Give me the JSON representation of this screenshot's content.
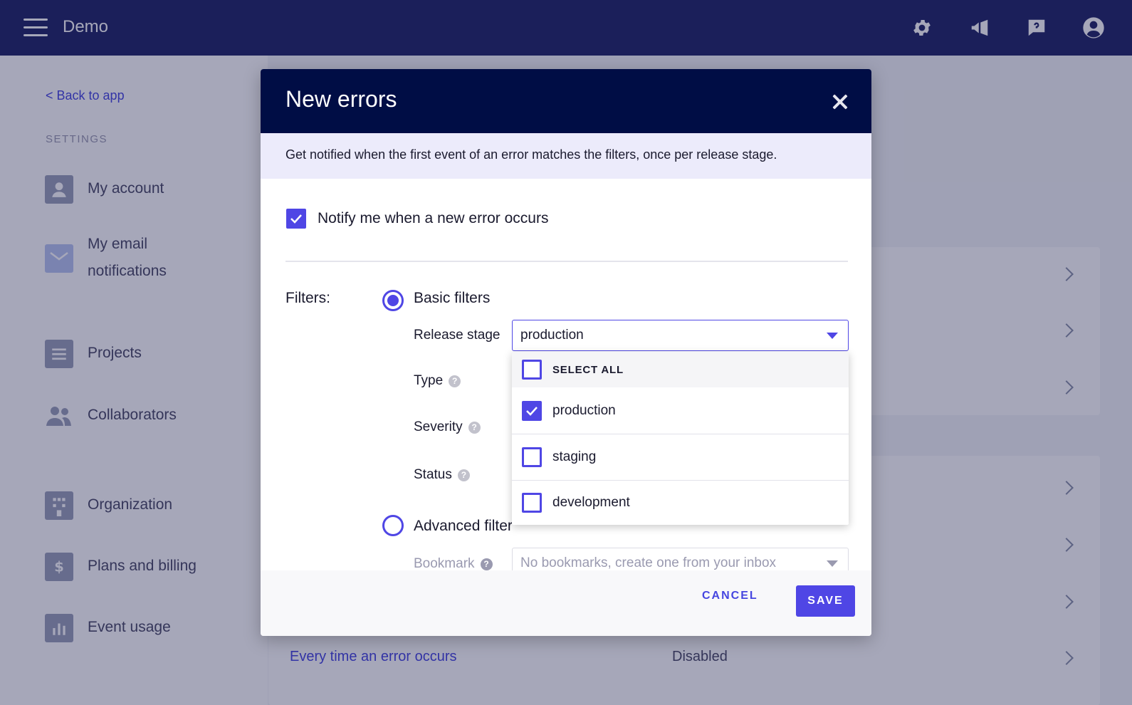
{
  "topbar": {
    "app_title": "Demo",
    "icons": [
      "settings-icon",
      "announcement-icon",
      "help-icon",
      "account-icon"
    ]
  },
  "sidebar": {
    "back_link": "< Back to app",
    "heading": "SETTINGS",
    "items": [
      {
        "label": "My account",
        "icon": "user-icon"
      },
      {
        "label": "My email\nnotifications",
        "icon": "email-icon"
      },
      {
        "label": "Projects",
        "icon": "projects-icon"
      },
      {
        "label": "Collaborators",
        "icon": "collaborators-icon"
      },
      {
        "label": "Organization",
        "icon": "organization-icon"
      },
      {
        "label": "Plans and billing",
        "icon": "billing-icon"
      },
      {
        "label": "Event usage",
        "icon": "usage-icon"
      }
    ]
  },
  "background": {
    "link": "Every time an error occurs",
    "status": "Disabled"
  },
  "modal": {
    "title": "New errors",
    "description": "Get notified when the first event of an error matches the filters, once per release stage.",
    "notify_label": "Notify me when a new error occurs",
    "notify_checked": true,
    "filters_label": "Filters:",
    "basic_filters_label": "Basic filters",
    "basic_filters_selected": true,
    "release_stage_label": "Release stage",
    "release_stage_value": "production",
    "type_label": "Type",
    "severity_label": "Severity",
    "status_label": "Status",
    "advanced_filter_label": "Advanced filter",
    "bookmark_label": "Bookmark",
    "bookmark_placeholder": "No bookmarks, create one from your inbox",
    "dropdown": {
      "select_all": "SELECT ALL",
      "options": [
        {
          "label": "production",
          "checked": true
        },
        {
          "label": "staging",
          "checked": false
        },
        {
          "label": "development",
          "checked": false
        }
      ]
    },
    "cancel_label": "CANCEL",
    "save_label": "SAVE"
  },
  "colors": {
    "topbar": "#1f2566",
    "modal_header": "#000d45",
    "accent": "#4f46e5",
    "description_bg": "#ecebfb"
  }
}
